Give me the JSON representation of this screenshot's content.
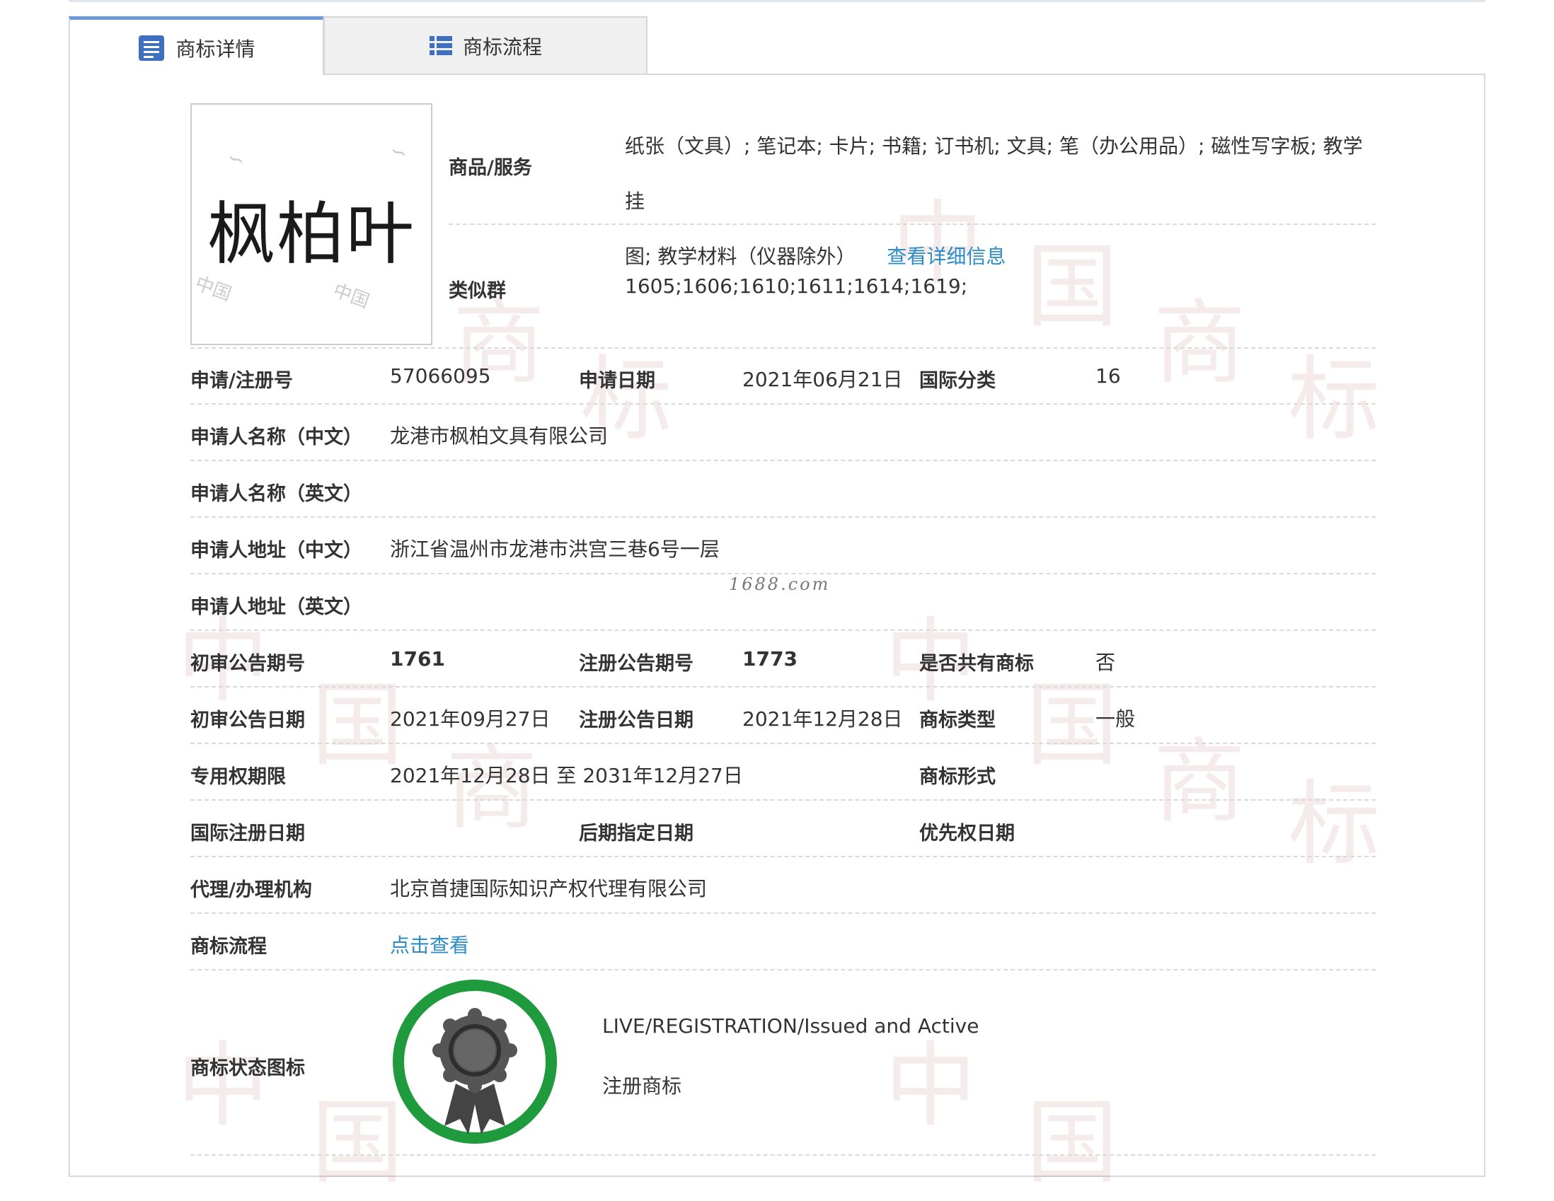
{
  "tabs": [
    {
      "label": "商标详情",
      "icon": "document-list-icon",
      "active": true
    },
    {
      "label": "商标流程",
      "icon": "list-icon",
      "active": false
    }
  ],
  "logo": {
    "text": "枫柏叶",
    "watermark": "中国"
  },
  "goods": {
    "label": "商品/服务",
    "line1": "纸张（文具）; 笔记本; 卡片; 书籍; 订书机; 文具; 笔（办公用品）; 磁性写字板; 教学挂",
    "line2": "图; 教学材料（仪器除外）",
    "link": "查看详细信息"
  },
  "similar_group": {
    "label": "类似群",
    "value": "1605;1606;1610;1611;1614;1619;"
  },
  "fields": {
    "reg_no_label": "申请/注册号",
    "reg_no": "57066095",
    "apply_date_label": "申请日期",
    "apply_date": "2021年06月21日",
    "intl_class_label": "国际分类",
    "intl_class": "16",
    "applicant_cn_label": "申请人名称（中文）",
    "applicant_cn": "龙港市枫柏文具有限公司",
    "applicant_en_label": "申请人名称（英文）",
    "applicant_en": "",
    "address_cn_label": "申请人地址（中文）",
    "address_cn": "浙江省温州市龙港市洪宫三巷6号一层",
    "address_en_label": "申请人地址（英文）",
    "address_en": "",
    "prelim_no_label": "初审公告期号",
    "prelim_no": "1761",
    "reg_pub_no_label": "注册公告期号",
    "reg_pub_no": "1773",
    "shared_label": "是否共有商标",
    "shared": "否",
    "prelim_date_label": "初审公告日期",
    "prelim_date": "2021年09月27日",
    "reg_pub_date_label": "注册公告日期",
    "reg_pub_date": "2021年12月28日",
    "tm_type_label": "商标类型",
    "tm_type": "一般",
    "exclusive_label": "专用权期限",
    "exclusive": "2021年12月28日 至 2031年12月27日",
    "tm_form_label": "商标形式",
    "tm_form": "",
    "intl_reg_date_label": "国际注册日期",
    "intl_reg_date": "",
    "later_date_label": "后期指定日期",
    "later_date": "",
    "priority_date_label": "优先权日期",
    "priority_date": "",
    "agent_label": "代理/办理机构",
    "agent": "北京首捷国际知识产权代理有限公司",
    "process_label": "商标流程",
    "process_link": "点击查看",
    "status_icon_label": "商标状态图标",
    "status_en": "LIVE/REGISTRATION/Issued and Active",
    "status_cn": "注册商标"
  },
  "site_watermark": "1688.com",
  "bg_watermark_chars": [
    "中",
    "国",
    "商",
    "标"
  ],
  "colors": {
    "tab_accent": "#6d98d9",
    "link": "#2b8cc8",
    "badge_ring": "#1f9a3c",
    "badge_medal": "#555555"
  }
}
